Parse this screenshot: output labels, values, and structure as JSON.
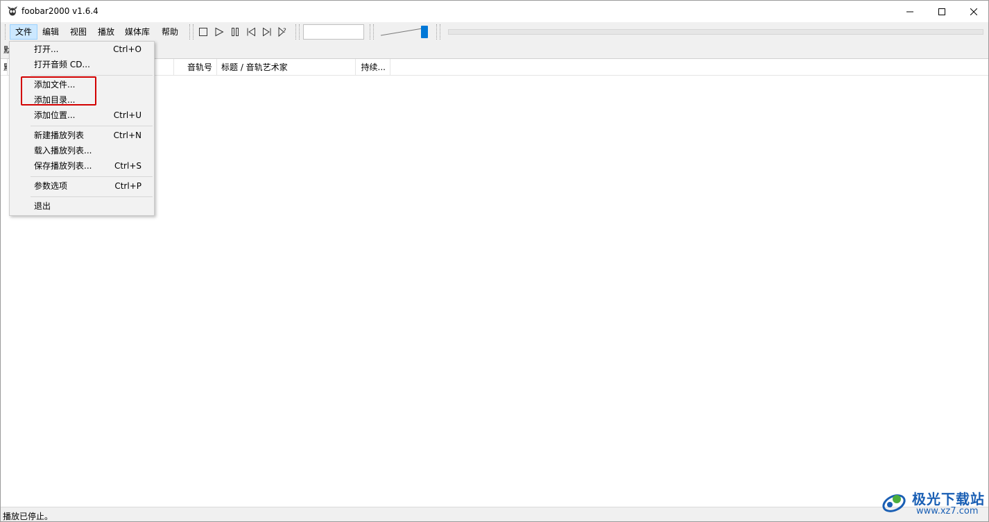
{
  "window": {
    "title": "foobar2000 v1.6.4"
  },
  "menubar": {
    "items": [
      {
        "label": "文件"
      },
      {
        "label": "编辑"
      },
      {
        "label": "视图"
      },
      {
        "label": "播放"
      },
      {
        "label": "媒体库"
      },
      {
        "label": "帮助"
      }
    ]
  },
  "toolbar": {
    "icons": [
      "stop-icon",
      "play-icon",
      "pause-icon",
      "previous-icon",
      "next-icon",
      "random-icon"
    ]
  },
  "tabstrip": {
    "stub_label": "默"
  },
  "columns": {
    "stub": "默",
    "track": "音轨号",
    "title": "标题 / 音轨艺术家",
    "duration": "持续..."
  },
  "file_menu": {
    "open": {
      "label": "打开...",
      "shortcut": "Ctrl+O"
    },
    "open_cd": {
      "label": "打开音频 CD..."
    },
    "add_files": {
      "label": "添加文件..."
    },
    "add_folder": {
      "label": "添加目录..."
    },
    "add_location": {
      "label": "添加位置...",
      "shortcut": "Ctrl+U"
    },
    "new_playlist": {
      "label": "新建播放列表",
      "shortcut": "Ctrl+N"
    },
    "load_playlist": {
      "label": "载入播放列表..."
    },
    "save_playlist": {
      "label": "保存播放列表...",
      "shortcut": "Ctrl+S"
    },
    "preferences": {
      "label": "参数选项",
      "shortcut": "Ctrl+P"
    },
    "exit": {
      "label": "退出"
    }
  },
  "status": {
    "text": "播放已停止。"
  },
  "watermark": {
    "brand": "极光下载站",
    "url": "www.xz7.com"
  },
  "colors": {
    "menu_active_bg": "#cce8ff",
    "volume_thumb": "#0078d7",
    "highlight_border": "#d20000",
    "watermark": "#1a5fb4"
  }
}
